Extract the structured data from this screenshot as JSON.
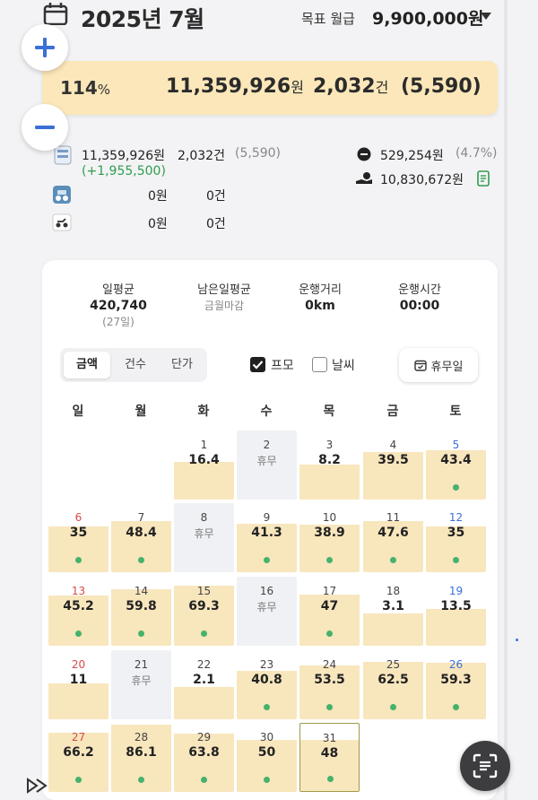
{
  "header": {
    "title": "2025년 7월",
    "target_label": "목표 월급",
    "target_value": "9,900,000원"
  },
  "summary": {
    "percent": "114",
    "percent_unit": "%",
    "amount": "11,359,926",
    "amount_unit": "원",
    "count": "2,032",
    "count_unit": "건",
    "sub": "(5,590)"
  },
  "breakdown": {
    "row1": {
      "amount": "11,359,926원",
      "count": "2,032건",
      "sub": "(5,590)",
      "delta": "(+1,955,500)"
    },
    "row2": {
      "amount": "0원",
      "count": "0건"
    },
    "row3": {
      "amount": "0원",
      "count": "0건"
    },
    "deduction": {
      "amount": "529,254원",
      "rate": "(4.7%)"
    },
    "net": {
      "amount": "10,830,672원"
    }
  },
  "stats": [
    {
      "label": "일평균",
      "value": "420,740",
      "sub": "(27일)"
    },
    {
      "label": "남은일평균",
      "value": "",
      "sub": "금월마감"
    },
    {
      "label": "운행거리",
      "value": "0km",
      "sub": ""
    },
    {
      "label": "운행시간",
      "value": "00:00",
      "sub": ""
    }
  ],
  "segment": {
    "items": [
      "금액",
      "건수",
      "단가"
    ],
    "active": 0
  },
  "filters": {
    "promo_label": "프모",
    "promo_checked": true,
    "weather_label": "날씨",
    "weather_checked": false,
    "holiday_label": "휴무일"
  },
  "calendar": {
    "weekdays": [
      "일",
      "월",
      "화",
      "수",
      "목",
      "금",
      "토"
    ],
    "fill_scale_max": 90,
    "days": [
      {
        "day": "1",
        "value": "16.4"
      },
      {
        "day": "2",
        "value": "휴무",
        "off": true
      },
      {
        "day": "3",
        "value": "8.2"
      },
      {
        "day": "4",
        "value": "39.5"
      },
      {
        "day": "5",
        "value": "43.4",
        "dot": true
      },
      {
        "day": "6",
        "value": "35",
        "dot": true
      },
      {
        "day": "7",
        "value": "48.4",
        "dot": true
      },
      {
        "day": "8",
        "value": "휴무",
        "off": true
      },
      {
        "day": "9",
        "value": "41.3",
        "dot": true
      },
      {
        "day": "10",
        "value": "38.9",
        "dot": true
      },
      {
        "day": "11",
        "value": "47.6",
        "dot": true
      },
      {
        "day": "12",
        "value": "35",
        "dot": true
      },
      {
        "day": "13",
        "value": "45.2",
        "dot": true
      },
      {
        "day": "14",
        "value": "59.8",
        "dot": true
      },
      {
        "day": "15",
        "value": "69.3",
        "dot": true
      },
      {
        "day": "16",
        "value": "휴무",
        "off": true
      },
      {
        "day": "17",
        "value": "47",
        "dot": true
      },
      {
        "day": "18",
        "value": "3.1"
      },
      {
        "day": "19",
        "value": "13.5"
      },
      {
        "day": "20",
        "value": "11"
      },
      {
        "day": "21",
        "value": "휴무",
        "off": true
      },
      {
        "day": "22",
        "value": "2.1"
      },
      {
        "day": "23",
        "value": "40.8",
        "dot": true
      },
      {
        "day": "24",
        "value": "53.5",
        "dot": true
      },
      {
        "day": "25",
        "value": "62.5",
        "dot": true
      },
      {
        "day": "26",
        "value": "59.3",
        "dot": true
      },
      {
        "day": "27",
        "value": "66.2",
        "dot": true
      },
      {
        "day": "28",
        "value": "86.1",
        "dot": true
      },
      {
        "day": "29",
        "value": "63.8",
        "dot": true
      },
      {
        "day": "30",
        "value": "50",
        "dot": true
      },
      {
        "day": "31",
        "value": "48",
        "dot": true,
        "today": true
      }
    ]
  },
  "colors": {
    "accent": "#3b6fd6",
    "summary_bg": "#fbe7b9",
    "cell_fill": "#f8e6bd",
    "dot": "#46b26c",
    "sunday": "#d64b4b",
    "saturday": "#3b6fd6"
  }
}
